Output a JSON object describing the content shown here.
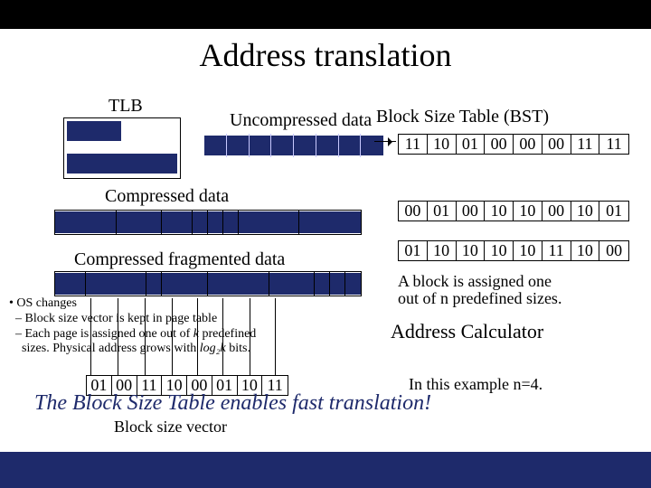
{
  "title": "Address translation",
  "tlb_label": "TLB",
  "uncompressed_label": "Uncompressed data",
  "bst_title": "Block Size Table (BST)",
  "compressed_label": "Compressed data",
  "frag_label": "Compressed fragmented data",
  "block_assigned": {
    "line1": "A block is assigned one",
    "line2": "out of n predefined sizes."
  },
  "addr_calc": "Address Calculator",
  "os_text": {
    "top": "OS changes",
    "line1_a": "Block size vector is kept in page table",
    "line2_a": "Each page is assigned one out of ",
    "line2_k": "k",
    "line2_b": " predefined",
    "line3_a": "sizes. Physical address grows with ",
    "line3_log": "log₂k",
    "line3_b": " bits."
  },
  "bst_rows": {
    "r0": [
      "11",
      "10",
      "01",
      "00",
      "00",
      "00",
      "11",
      "11"
    ],
    "r1": [
      "00",
      "01",
      "00",
      "10",
      "10",
      "00",
      "10",
      "01"
    ],
    "r2": [
      "01",
      "10",
      "10",
      "10",
      "10",
      "11",
      "10",
      "00"
    ]
  },
  "bsv": [
    "01",
    "00",
    "11",
    "10",
    "00",
    "01",
    "10",
    "11"
  ],
  "bsv_label": "Block size vector",
  "n_example": "In this example n=4.",
  "big_line": "The Block Size Table enables fast translation!",
  "chart_data": {
    "type": "table",
    "title": "Address translation — Block Size Table rows and block size vector",
    "bst_rows": [
      [
        "11",
        "10",
        "01",
        "00",
        "00",
        "00",
        "11",
        "11"
      ],
      [
        "00",
        "01",
        "00",
        "10",
        "10",
        "00",
        "10",
        "01"
      ],
      [
        "01",
        "10",
        "10",
        "10",
        "10",
        "11",
        "10",
        "00"
      ]
    ],
    "block_size_vector": [
      "01",
      "00",
      "11",
      "10",
      "00",
      "01",
      "10",
      "11"
    ],
    "uncompressed_segments": 8,
    "compressed_segments": 8,
    "fragmented_segments": 9,
    "n": 4
  }
}
